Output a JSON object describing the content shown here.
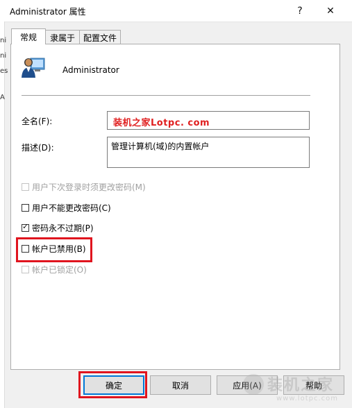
{
  "window": {
    "title": "Administrator 属性",
    "help_glyph": "?",
    "close_glyph": "✕"
  },
  "left_edge": {
    "chars": [
      "ni",
      "ni",
      "es",
      "A"
    ]
  },
  "tabs": [
    {
      "label": "常规",
      "active": true
    },
    {
      "label": "隶属于",
      "active": false
    },
    {
      "label": "配置文件",
      "active": false
    }
  ],
  "user": {
    "name": "Administrator",
    "icon": "user-account-icon"
  },
  "fields": {
    "fullname_label": "全名(F):",
    "fullname_value": "装机之家Lotpc. com",
    "description_label": "描述(D):",
    "description_value": "管理计算机(域)的内置帐户"
  },
  "checkboxes": [
    {
      "label": "用户下次登录时须更改密码(M)",
      "checked": false,
      "disabled": true
    },
    {
      "label": "用户不能更改密码(C)",
      "checked": false,
      "disabled": false
    },
    {
      "label": "密码永不过期(P)",
      "checked": true,
      "disabled": false
    },
    {
      "label": "帐户已禁用(B)",
      "checked": false,
      "disabled": false
    },
    {
      "label": "帐户已锁定(O)",
      "checked": false,
      "disabled": true
    }
  ],
  "buttons": {
    "ok": "确定",
    "cancel": "取消",
    "apply": "应用(A)",
    "help": "帮助"
  },
  "watermark": {
    "text": "装机之家",
    "url": "www.lotpc.com"
  },
  "colors": {
    "highlight": "#e0141e",
    "fullname_text": "#e02020",
    "primary_border": "#0078d7"
  }
}
